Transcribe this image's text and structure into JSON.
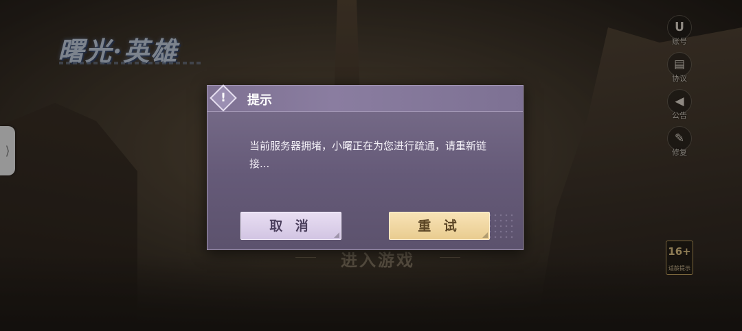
{
  "app": {
    "logo_text": "曙光·英雄"
  },
  "side_handle": {
    "glyph": "⟩"
  },
  "right_menu": [
    {
      "label": "账号",
      "icon": "account-icon",
      "glyph": "ꟾ"
    },
    {
      "label": "协议",
      "icon": "agreement-icon",
      "glyph": "▤"
    },
    {
      "label": "公告",
      "icon": "megaphone-icon",
      "glyph": "📢"
    },
    {
      "label": "修复",
      "icon": "wrench-icon",
      "glyph": "🔧"
    }
  ],
  "age_badge": {
    "rating": "16+",
    "label": "适龄提示"
  },
  "enter_game": {
    "label": "进入游戏"
  },
  "dialog": {
    "title": "提示",
    "warning_glyph": "!",
    "message": "当前服务器拥堵，小曙正在为您进行疏通，请重新链接...",
    "cancel_label": "取 消",
    "retry_label": "重 试"
  },
  "colors": {
    "dialog_bg": "#6a5f7d",
    "cancel_button": "#ddd2ea",
    "retry_button": "#f1d9a4"
  }
}
